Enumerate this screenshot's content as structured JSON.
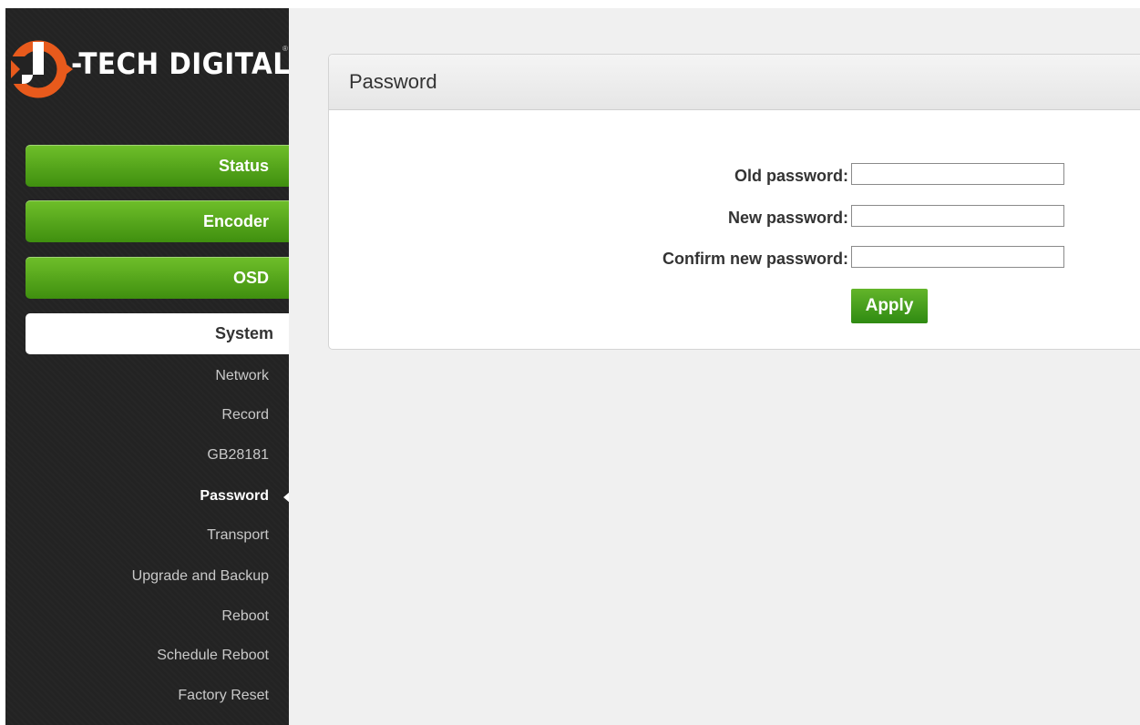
{
  "brand": {
    "name": "-TECH DIGITAL",
    "registered": "®",
    "accent_color": "#e85a1c"
  },
  "nav": {
    "main_items": [
      {
        "label": "Status"
      },
      {
        "label": "Encoder"
      },
      {
        "label": "OSD"
      },
      {
        "label": "System"
      }
    ],
    "sub_items": [
      {
        "label": "Network"
      },
      {
        "label": "Record"
      },
      {
        "label": "GB28181"
      },
      {
        "label": "Password"
      },
      {
        "label": "Transport"
      },
      {
        "label": "Upgrade and Backup"
      },
      {
        "label": "Reboot"
      },
      {
        "label": "Schedule Reboot"
      },
      {
        "label": "Factory Reset"
      }
    ],
    "active_main": "System",
    "active_sub": "Password"
  },
  "panel": {
    "title": "Password",
    "old_password_label": "Old password:",
    "new_password_label": "New password:",
    "confirm_password_label": "Confirm new password:",
    "old_password_value": "",
    "new_password_value": "",
    "confirm_password_value": "",
    "apply_label": "Apply"
  }
}
